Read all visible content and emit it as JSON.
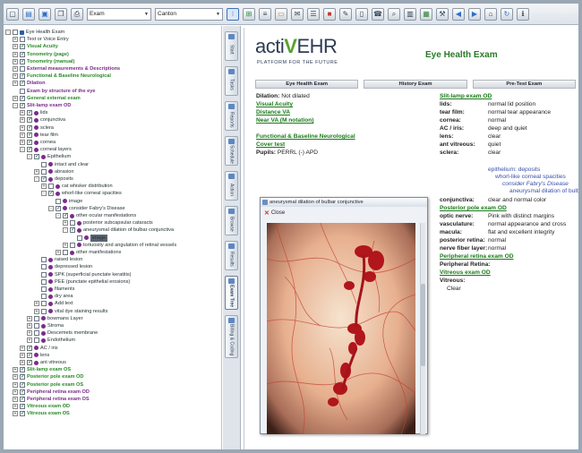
{
  "toolbar": {
    "select1": "Exam",
    "select2": "Canton"
  },
  "tree": [
    {
      "indent": 0,
      "exp": "-",
      "chk": "",
      "dot": "sq",
      "label": "Eye Health Exam",
      "style": "plain"
    },
    {
      "indent": 1,
      "exp": "+",
      "chk": "",
      "dot": "",
      "label": "Text or Voice Entry",
      "style": "plain"
    },
    {
      "indent": 1,
      "exp": "+",
      "chk": "✓",
      "dot": "",
      "label": "Visual Acuity",
      "style": "green"
    },
    {
      "indent": 1,
      "exp": "+",
      "chk": "✓",
      "dot": "",
      "label": "Tonometry (page)",
      "style": "green"
    },
    {
      "indent": 1,
      "exp": "+",
      "chk": "✓",
      "dot": "",
      "label": "Tonometry (manual)",
      "style": "green"
    },
    {
      "indent": 1,
      "exp": "+",
      "chk": "",
      "dot": "",
      "label": "External measurements & Descriptions",
      "style": "purple"
    },
    {
      "indent": 1,
      "exp": "+",
      "chk": "✓",
      "dot": "",
      "label": "Functional & Baseline Neurological",
      "style": "green"
    },
    {
      "indent": 1,
      "exp": "+",
      "chk": "✓",
      "dot": "",
      "label": "Dilation",
      "style": "purple"
    },
    {
      "indent": 1,
      "exp": "",
      "chk": "",
      "dot": "",
      "label": "Exam by structure of the eye",
      "style": "purple"
    },
    {
      "indent": 1,
      "exp": "+",
      "chk": "✓",
      "dot": "",
      "label": "General external exam",
      "style": "green"
    },
    {
      "indent": 1,
      "exp": "-",
      "chk": "✓",
      "dot": "",
      "label": "Slit-lamp exam OD",
      "style": "purple"
    },
    {
      "indent": 2,
      "exp": "+",
      "chk": "✓",
      "dot": "dot",
      "label": "lids",
      "style": "plain"
    },
    {
      "indent": 2,
      "exp": "+",
      "chk": "✓",
      "dot": "dot",
      "label": "conjunctiva",
      "style": "plain"
    },
    {
      "indent": 2,
      "exp": "+",
      "chk": "✓",
      "dot": "dot",
      "label": "sclera",
      "style": "plain"
    },
    {
      "indent": 2,
      "exp": "+",
      "chk": "✓",
      "dot": "dot",
      "label": "tear film",
      "style": "plain"
    },
    {
      "indent": 2,
      "exp": "+",
      "chk": "✓",
      "dot": "dot",
      "label": "cornea",
      "style": "plain"
    },
    {
      "indent": 2,
      "exp": "-",
      "chk": "✓",
      "dot": "dot",
      "label": "corneal layers",
      "style": "plain"
    },
    {
      "indent": 3,
      "exp": "-",
      "chk": "✓",
      "dot": "dot",
      "label": "Epithelium",
      "style": "plain"
    },
    {
      "indent": 4,
      "exp": "",
      "chk": "",
      "dot": "dot",
      "label": "intact and clear",
      "style": "plain"
    },
    {
      "indent": 4,
      "exp": "+",
      "chk": "",
      "dot": "dot",
      "label": "abrasion",
      "style": "plain"
    },
    {
      "indent": 4,
      "exp": "-",
      "chk": "✓",
      "dot": "dot",
      "label": "deposits",
      "style": "plain"
    },
    {
      "indent": 5,
      "exp": "+",
      "chk": "",
      "dot": "dot",
      "label": "cat whisker distribution",
      "style": "plain"
    },
    {
      "indent": 5,
      "exp": "-",
      "chk": "✓",
      "dot": "dot",
      "label": "whorl-like corneal spacities",
      "style": "plain"
    },
    {
      "indent": 6,
      "exp": "",
      "chk": "",
      "dot": "dot",
      "label": "image",
      "style": "plain"
    },
    {
      "indent": 6,
      "exp": "-",
      "chk": "✓",
      "dot": "dot",
      "label": "consider Fabry's Disease",
      "style": "plain"
    },
    {
      "indent": 7,
      "exp": "-",
      "chk": "✓",
      "dot": "dot",
      "label": "other ocular manifestations",
      "style": "plain"
    },
    {
      "indent": 8,
      "exp": "+",
      "chk": "",
      "dot": "dot",
      "label": "posterior subcapsular cataracts",
      "style": "plain"
    },
    {
      "indent": 8,
      "exp": "-",
      "chk": "✓",
      "dot": "dot",
      "label": "aneurysmal dilation of bulbar conjunctiva",
      "style": "plain"
    },
    {
      "indent": 9,
      "exp": "",
      "chk": "",
      "dot": "dot",
      "label": "image",
      "style": "selected"
    },
    {
      "indent": 8,
      "exp": "+",
      "chk": "",
      "dot": "dot",
      "label": "tortuosity and angulation of retinal vessels",
      "style": "plain"
    },
    {
      "indent": 7,
      "exp": "+",
      "chk": "",
      "dot": "dot",
      "label": "other manifestations",
      "style": "plain"
    },
    {
      "indent": 4,
      "exp": "",
      "chk": "",
      "dot": "dot",
      "label": "raised lesion",
      "style": "plain"
    },
    {
      "indent": 4,
      "exp": "",
      "chk": "",
      "dot": "dot",
      "label": "depressed lesion",
      "style": "plain"
    },
    {
      "indent": 4,
      "exp": "",
      "chk": "",
      "dot": "dot",
      "label": "SPK (superficial punctate keratitis)",
      "style": "plain"
    },
    {
      "indent": 4,
      "exp": "",
      "chk": "",
      "dot": "dot",
      "label": "PEE (punctate epithelial erosions)",
      "style": "plain"
    },
    {
      "indent": 4,
      "exp": "",
      "chk": "",
      "dot": "dot",
      "label": "filaments",
      "style": "plain"
    },
    {
      "indent": 4,
      "exp": "",
      "chk": "",
      "dot": "dot",
      "label": "dry area",
      "style": "plain"
    },
    {
      "indent": 4,
      "exp": "+",
      "chk": "",
      "dot": "dot",
      "label": "Add text",
      "style": "plain"
    },
    {
      "indent": 4,
      "exp": "+",
      "chk": "",
      "dot": "dot",
      "label": "vital dye staining results",
      "style": "plain"
    },
    {
      "indent": 3,
      "exp": "+",
      "chk": "",
      "dot": "dot",
      "label": "bowmans Layer",
      "style": "plain"
    },
    {
      "indent": 3,
      "exp": "+",
      "chk": "",
      "dot": "dot",
      "label": "Stroma",
      "style": "plain"
    },
    {
      "indent": 3,
      "exp": "+",
      "chk": "",
      "dot": "dot",
      "label": "Descemets membrane",
      "style": "plain"
    },
    {
      "indent": 3,
      "exp": "+",
      "chk": "",
      "dot": "dot",
      "label": "Endothelium",
      "style": "plain"
    },
    {
      "indent": 2,
      "exp": "+",
      "chk": "✓",
      "dot": "dot",
      "label": "AC / iris",
      "style": "plain"
    },
    {
      "indent": 2,
      "exp": "+",
      "chk": "✓",
      "dot": "dot",
      "label": "lens",
      "style": "plain"
    },
    {
      "indent": 2,
      "exp": "+",
      "chk": "✓",
      "dot": "dot",
      "label": "ant vitreous",
      "style": "plain"
    },
    {
      "indent": 1,
      "exp": "+",
      "chk": "✓",
      "dot": "",
      "label": "Slit-lamp exam OS",
      "style": "green"
    },
    {
      "indent": 1,
      "exp": "+",
      "chk": "✓",
      "dot": "",
      "label": "Posterior pole exam OD",
      "style": "green"
    },
    {
      "indent": 1,
      "exp": "+",
      "chk": "✓",
      "dot": "",
      "label": "Posterior pole exam OS",
      "style": "green"
    },
    {
      "indent": 1,
      "exp": "+",
      "chk": "✓",
      "dot": "",
      "label": "Peripheral retina exam OD",
      "style": "purple"
    },
    {
      "indent": 1,
      "exp": "+",
      "chk": "✓",
      "dot": "",
      "label": "Peripheral retina exam OS",
      "style": "purple"
    },
    {
      "indent": 1,
      "exp": "+",
      "chk": "✓",
      "dot": "",
      "label": "Vitreous exam OD",
      "style": "green"
    },
    {
      "indent": 1,
      "exp": "+",
      "chk": "✓",
      "dot": "",
      "label": "Vitreous exam OS",
      "style": "green"
    }
  ],
  "side_tabs": [
    "Start",
    "Tasks",
    "Reports",
    "Schedule",
    "Action",
    "Browse",
    "Results",
    "Exam Tree",
    "Billing & Coding"
  ],
  "doc": {
    "logo_prefix": "acti",
    "logo_v": "V",
    "logo_suffix": "EHR",
    "logo_tagline": "PLATFORM FOR THE FUTURE",
    "title": "Eye Health Exam",
    "tabs": [
      "Eye Health Exam",
      "History Exam",
      "Pre-Test Exam"
    ],
    "dilation_label": "Dilation:",
    "dilation_value": "Not dilated",
    "visual_acuity": "Visual Acuity",
    "distance_va": "Distance VA",
    "near_va": "Near VA (M notation)",
    "functional": "Functional & Baseline Neurological",
    "cover_test": "Cover test",
    "pupils_label": "Pupils:",
    "pupils_value": "PERRL (-) APD",
    "slit_od": "Slit-lamp exam OD",
    "slit_rows": [
      {
        "k": "lids:",
        "v": "normal lid position"
      },
      {
        "k": "tear film:",
        "v": "normal tear appearance"
      },
      {
        "k": "cornea:",
        "v": "normal"
      },
      {
        "k": "AC / iris:",
        "v": "deep and quiet"
      },
      {
        "k": "lens:",
        "v": "clear"
      },
      {
        "k": "ant vitreous:",
        "v": "quiet"
      },
      {
        "k": "sclera:",
        "v": "clear"
      }
    ],
    "epithelium": "epithelium: deposits",
    "whorl": "whorl-like corneal spacities",
    "consider": "consider Fabry's Disease",
    "aneurysmal": "aneurysmal dilation of bulba",
    "conj_label": "conjunctiva:",
    "conj_value": "clear and normal color",
    "post_od": "Posterior pole exam OD",
    "post_rows": [
      {
        "k": "optic nerve:",
        "v": "Pink with distinct margins"
      },
      {
        "k": "vasculature:",
        "v": "normal appearance and cross"
      },
      {
        "k": "macula:",
        "v": "flat and excellent integrity"
      },
      {
        "k": "posterior retina:",
        "v": "normal"
      },
      {
        "k": "nerve fiber layer:",
        "v": "normal"
      }
    ],
    "periph_od": "Peripheral retina exam OD",
    "periph_label": "Peripheral Retina:",
    "vitreous_od": "Vitreous exam OD",
    "vitreous_label": "Vitreous:",
    "vitreous_value": "Clear"
  },
  "popup": {
    "title": "aneurysmal dilation of bulbar conjunctive",
    "close_label": "Close"
  },
  "colors": {
    "green_link": "#1a7a1a",
    "purple_label": "#7a2d8a",
    "selection": "#5a6472"
  }
}
